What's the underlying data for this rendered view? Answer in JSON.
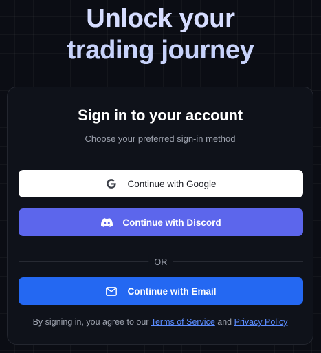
{
  "hero": {
    "title_line_1": "Unlock your",
    "title_line_2": "trading journey"
  },
  "card": {
    "title": "Sign in to your account",
    "subtitle": "Choose your preferred sign-in method"
  },
  "buttons": {
    "google": {
      "label": "Continue with Google",
      "icon": "google-icon"
    },
    "discord": {
      "label": "Continue with Discord",
      "icon": "discord-icon"
    },
    "email": {
      "label": "Continue with Email",
      "icon": "mail-icon"
    }
  },
  "divider": {
    "text": "OR"
  },
  "legal": {
    "prefix": "By signing in, you agree to our ",
    "terms_link": "Terms of Service",
    "conjunction": " and ",
    "privacy_link": "Privacy Policy"
  },
  "colors": {
    "background": "#0b0d14",
    "card": "#0f121a",
    "google_button": "#ffffff",
    "discord_button": "#5c66ec",
    "email_button": "#2468f2",
    "link": "#5b8cff"
  }
}
